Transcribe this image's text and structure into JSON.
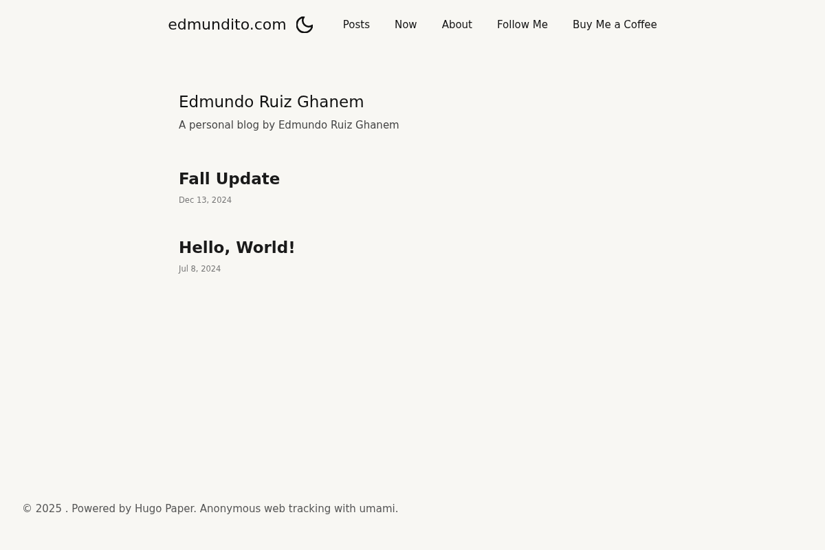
{
  "site": {
    "name": "edmundito.com"
  },
  "nav": [
    {
      "label": "Posts"
    },
    {
      "label": "Now"
    },
    {
      "label": "About"
    },
    {
      "label": "Follow Me"
    },
    {
      "label": "Buy Me a Coffee"
    }
  ],
  "profile": {
    "name": "Edmundo Ruiz Ghanem",
    "tagline": "A personal blog by Edmundo Ruiz Ghanem"
  },
  "posts": [
    {
      "title": "Fall Update",
      "date": "Dec 13, 2024"
    },
    {
      "title": "Hello, World!",
      "date": "Jul 8, 2024"
    }
  ],
  "footer": {
    "text": "© 2025 . Powered by Hugo Paper. Anonymous web tracking with umami."
  }
}
